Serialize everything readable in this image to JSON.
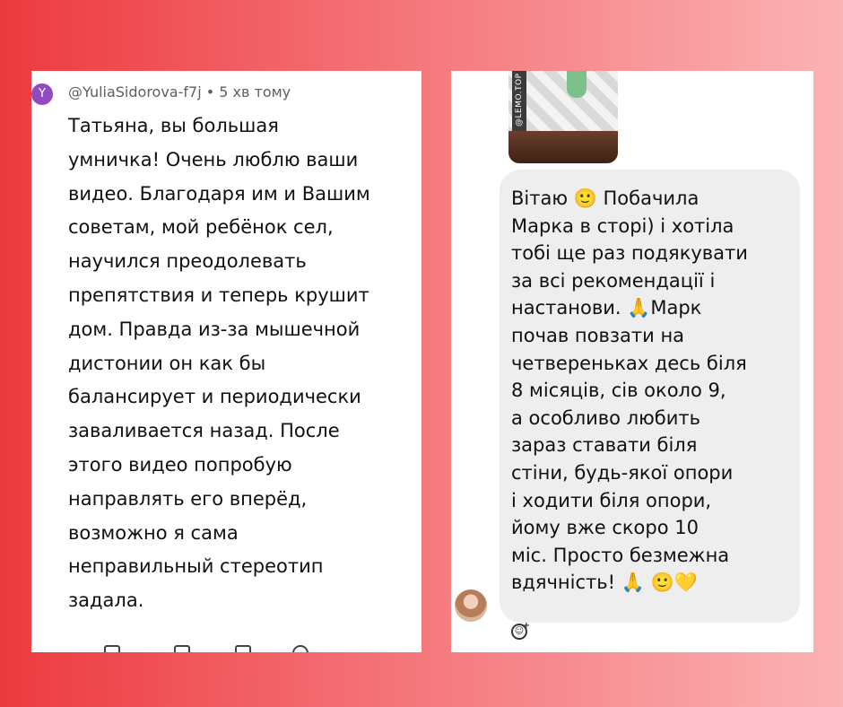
{
  "left_comment": {
    "avatar_letter": "Y",
    "author": "@YuliaSidorova-f7j",
    "separator": " • ",
    "time": "5 хв тому",
    "lines": [
      "Татьяна, вы большая",
      "умничка! Очень люблю ваши",
      "видео. Благодаря им и Вашим",
      "советам, мой ребёнок сел,",
      "научился преодолевать",
      "препятствия и теперь крушит",
      "дом. Правда из-за мышечной",
      "дистонии он как бы",
      "балансирует и периодически",
      "заваливается назад. После",
      "этого видео попробую",
      "направлять его вперёд,",
      "возможно я сама",
      "неправильный стереотип",
      "задала."
    ]
  },
  "right_message": {
    "photo_tag": "@LEMO.TOP",
    "lines": [
      "Вітаю 🙂  Побачила",
      "Марка в сторі) і хотіла",
      "тобі ще раз подякувати",
      "за всі рекомендації і",
      "настанови. 🙏Марк",
      "почав повзати на",
      "четвереньках десь біля",
      "8 місяців, сів около 9,",
      "а особливо любить",
      "зараз ставати біля",
      "стіни, будь-якої опори",
      "і ходити біля опори,",
      "йому вже скоро 10",
      "міс. Просто безмежна",
      "вдячність!  🙏 🙂💛"
    ],
    "reaction_icon": "add-reaction-icon"
  },
  "colors": {
    "background_left": "#ec3a3f",
    "background_right": "#fbb3b5",
    "avatar_purple": "#8f4bc2",
    "bubble_gray": "#eeeeee"
  }
}
